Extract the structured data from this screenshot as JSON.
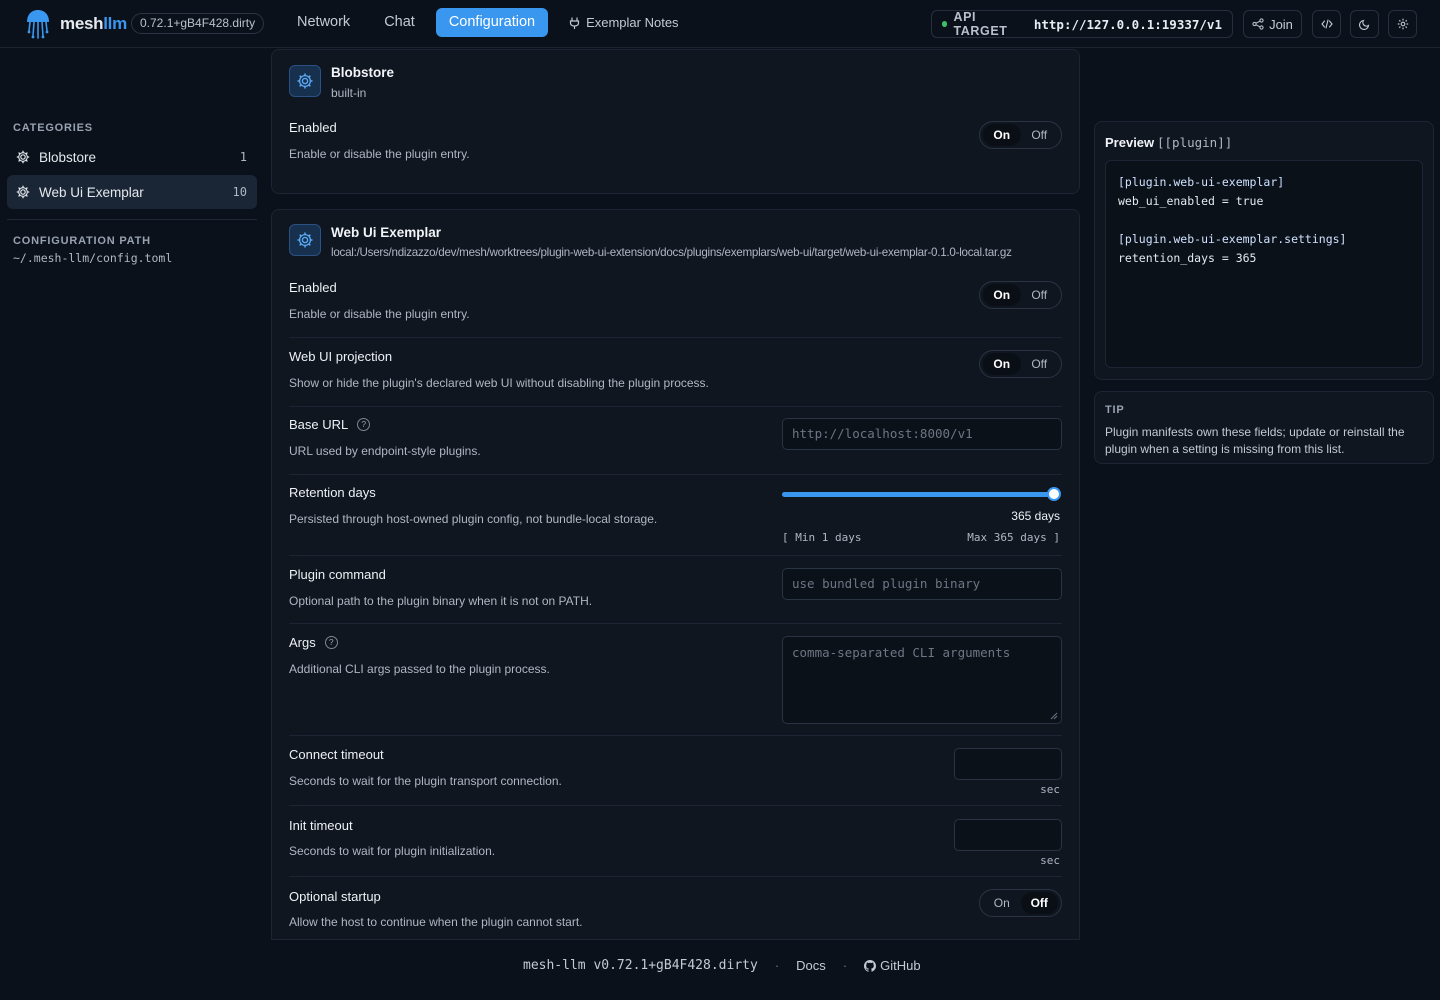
{
  "header": {
    "brand_prefix": "mesh",
    "brand_suffix": "llm",
    "version": "0.72.1+gB4F428.dirty",
    "nav": [
      {
        "label": "Network"
      },
      {
        "label": "Chat"
      },
      {
        "label": "Configuration"
      },
      {
        "label": "Exemplar Notes"
      }
    ],
    "api_target_label": "API TARGET",
    "api_target_url": "http://127.0.0.1:19337/v1",
    "join_label": "Join"
  },
  "sidebar": {
    "categories_heading": "CATEGORIES",
    "items": [
      {
        "label": "Blobstore",
        "count": "1"
      },
      {
        "label": "Web Ui Exemplar",
        "count": "10"
      }
    ],
    "config_path_heading": "CONFIGURATION PATH",
    "config_path": "~/.mesh-llm/config.toml"
  },
  "blobstore": {
    "title": "Blobstore",
    "subtitle": "built-in",
    "enabled_label": "Enabled",
    "enabled_desc": "Enable or disable the plugin entry."
  },
  "exemplar": {
    "title": "Web Ui Exemplar",
    "subtitle": "local:/Users/ndizazzo/dev/mesh/worktrees/plugin-web-ui-extension/docs/plugins/exemplars/web-ui/target/web-ui-exemplar-0.1.0-local.tar.gz",
    "enabled": {
      "label": "Enabled",
      "desc": "Enable or disable the plugin entry."
    },
    "projection": {
      "label": "Web UI projection",
      "desc": "Show or hide the plugin's declared web UI without disabling the plugin process."
    },
    "base_url": {
      "label": "Base URL",
      "desc": "URL used by endpoint-style plugins.",
      "placeholder": "http://localhost:8000/v1"
    },
    "retention": {
      "label": "Retention days",
      "desc": "Persisted through host-owned plugin config, not bundle-local storage.",
      "value_text": "365 days",
      "min_text": "[ Min 1 days",
      "max_text": "Max 365 days ]",
      "value": 365,
      "min": 1,
      "max": 365
    },
    "command": {
      "label": "Plugin command",
      "desc": "Optional path to the plugin binary when it is not on PATH.",
      "placeholder": "use bundled plugin binary"
    },
    "args": {
      "label": "Args",
      "desc": "Additional CLI args passed to the plugin process.",
      "placeholder": "comma-separated CLI arguments"
    },
    "connect_timeout": {
      "label": "Connect timeout",
      "desc": "Seconds to wait for the plugin transport connection.",
      "unit": "sec"
    },
    "init_timeout": {
      "label": "Init timeout",
      "desc": "Seconds to wait for plugin initialization.",
      "unit": "sec"
    },
    "optional_startup": {
      "label": "Optional startup",
      "desc": "Allow the host to continue when the plugin cannot start."
    }
  },
  "toggle": {
    "on": "On",
    "off": "Off"
  },
  "preview": {
    "title": "Preview",
    "tag": "[[plugin]]",
    "lines": [
      "[plugin.web-ui-exemplar]",
      "web_ui_enabled = true",
      "",
      "[plugin.web-ui-exemplar.settings]",
      "retention_days = 365"
    ]
  },
  "tip": {
    "heading": "TIP",
    "text": "Plugin manifests own these fields; update or reinstall the plugin when a setting is missing from this list."
  },
  "footer": {
    "version": "mesh-llm v0.72.1+gB4F428.dirty",
    "docs": "Docs",
    "github": "GitHub",
    "separator": "·"
  },
  "colors": {
    "accent": "#3a97f0",
    "background": "#0b111a",
    "panel": "#0f1620",
    "status_ok": "#34c36b"
  },
  "icons": [
    "jellyfish-logo",
    "plug-icon",
    "share-icon",
    "code-icon",
    "moon-icon",
    "gear-icon",
    "help-icon",
    "github-icon"
  ]
}
